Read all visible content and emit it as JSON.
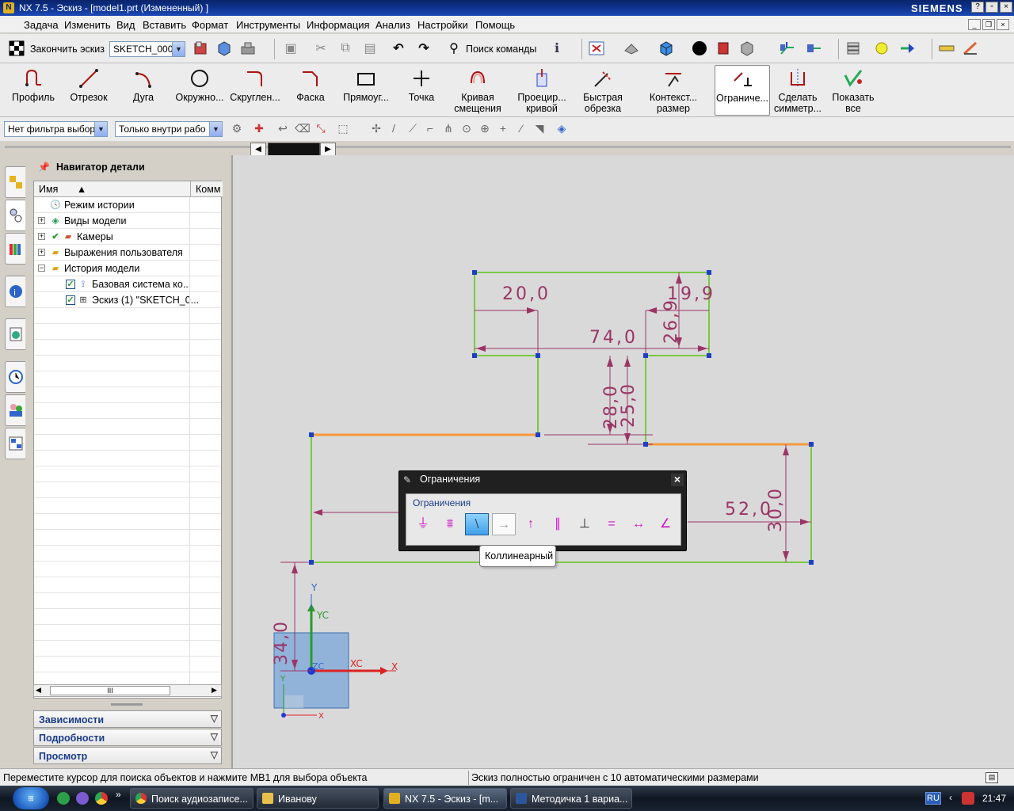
{
  "window": {
    "title": "NX 7.5 - Эскиз - [model1.prt (Измененный) ]",
    "brand": "SIEMENS",
    "min": "_",
    "max": "□",
    "close": "×"
  },
  "menu": [
    "Задача",
    "Изменить",
    "Вид",
    "Вставить",
    "Формат",
    "Инструменты",
    "Информация",
    "Анализ",
    "Настройки",
    "Помощь"
  ],
  "toolbar1": {
    "finish_sketch": "Закончить эскиз",
    "sketch_name": "SKETCH_000",
    "find_command": "Поиск команды"
  },
  "toolbar2": [
    {
      "label": "Профиль",
      "label2": ""
    },
    {
      "label": "Отрезок",
      "label2": ""
    },
    {
      "label": "Дуга",
      "label2": ""
    },
    {
      "label": "Окружно...",
      "label2": ""
    },
    {
      "label": "Скруглен...",
      "label2": ""
    },
    {
      "label": "Фаска",
      "label2": ""
    },
    {
      "label": "Прямоуг...",
      "label2": ""
    },
    {
      "label": "Точка",
      "label2": ""
    },
    {
      "label": "Кривая",
      "label2": "смещения"
    },
    {
      "label": "Проецир...",
      "label2": "кривой"
    },
    {
      "label": "Быстрая",
      "label2": "обрезка"
    },
    {
      "label": "Контекст...",
      "label2": "размер"
    },
    {
      "label": "Ограниче...",
      "label2": ""
    },
    {
      "label": "Сделать",
      "label2": "симметр..."
    },
    {
      "label": "Показать",
      "label2": "все"
    }
  ],
  "filters": {
    "type_filter": "Нет фильтра выбора",
    "scope_filter": "Только внутри рабо"
  },
  "navigator": {
    "title": "Навигатор детали",
    "col_name": "Имя",
    "col_comment": "Комм",
    "items": [
      {
        "label": "Режим истории"
      },
      {
        "label": "Виды модели"
      },
      {
        "label": "Камеры"
      },
      {
        "label": "Выражения пользователя"
      },
      {
        "label": "История модели"
      },
      {
        "label": "Базовая система ко..."
      },
      {
        "label": "Эскиз (1) \"SKETCH_0..."
      }
    ],
    "panels": [
      "Зависимости",
      "Подробности",
      "Просмотр"
    ]
  },
  "sketch": {
    "dims": [
      "20,0",
      "19,9",
      "74,0",
      "26,9",
      "28,0",
      "25,0",
      "52,0",
      "30,0",
      "34,0"
    ],
    "axes": {
      "y": "Y",
      "yc": "YC",
      "zc": "ZC",
      "xc": "XC",
      "x": "X",
      "y2": "Y",
      "x2": "X"
    }
  },
  "constraints_dialog": {
    "title": "Ограничения",
    "group": "Ограничения",
    "buttons": [
      "fixed",
      "fully-fixed",
      "collinear",
      "horizontal",
      "vertical",
      "parallel",
      "perpendicular",
      "equal-length",
      "constant-length",
      "constant-angle"
    ],
    "tooltip": "Коллинеарный"
  },
  "status": {
    "left": "Переместите курсор для поиска объектов и нажмите MB1 для выбора объекта",
    "right": "Эскиз полностью ограничен с 10 автоматическими размерами"
  },
  "taskbar": {
    "tasks": [
      "Поиск аудиозаписе...",
      "Иванову",
      "NX 7.5 - Эскиз - [m...",
      "Методичка 1 вариа..."
    ],
    "lang": "RU",
    "time": "21:47",
    "chevron": "»"
  },
  "colors": {
    "sketch_line": "#7ac943",
    "dim": "#9a3566",
    "highlight": "#f39a3c",
    "point": "#1c3fc9"
  }
}
